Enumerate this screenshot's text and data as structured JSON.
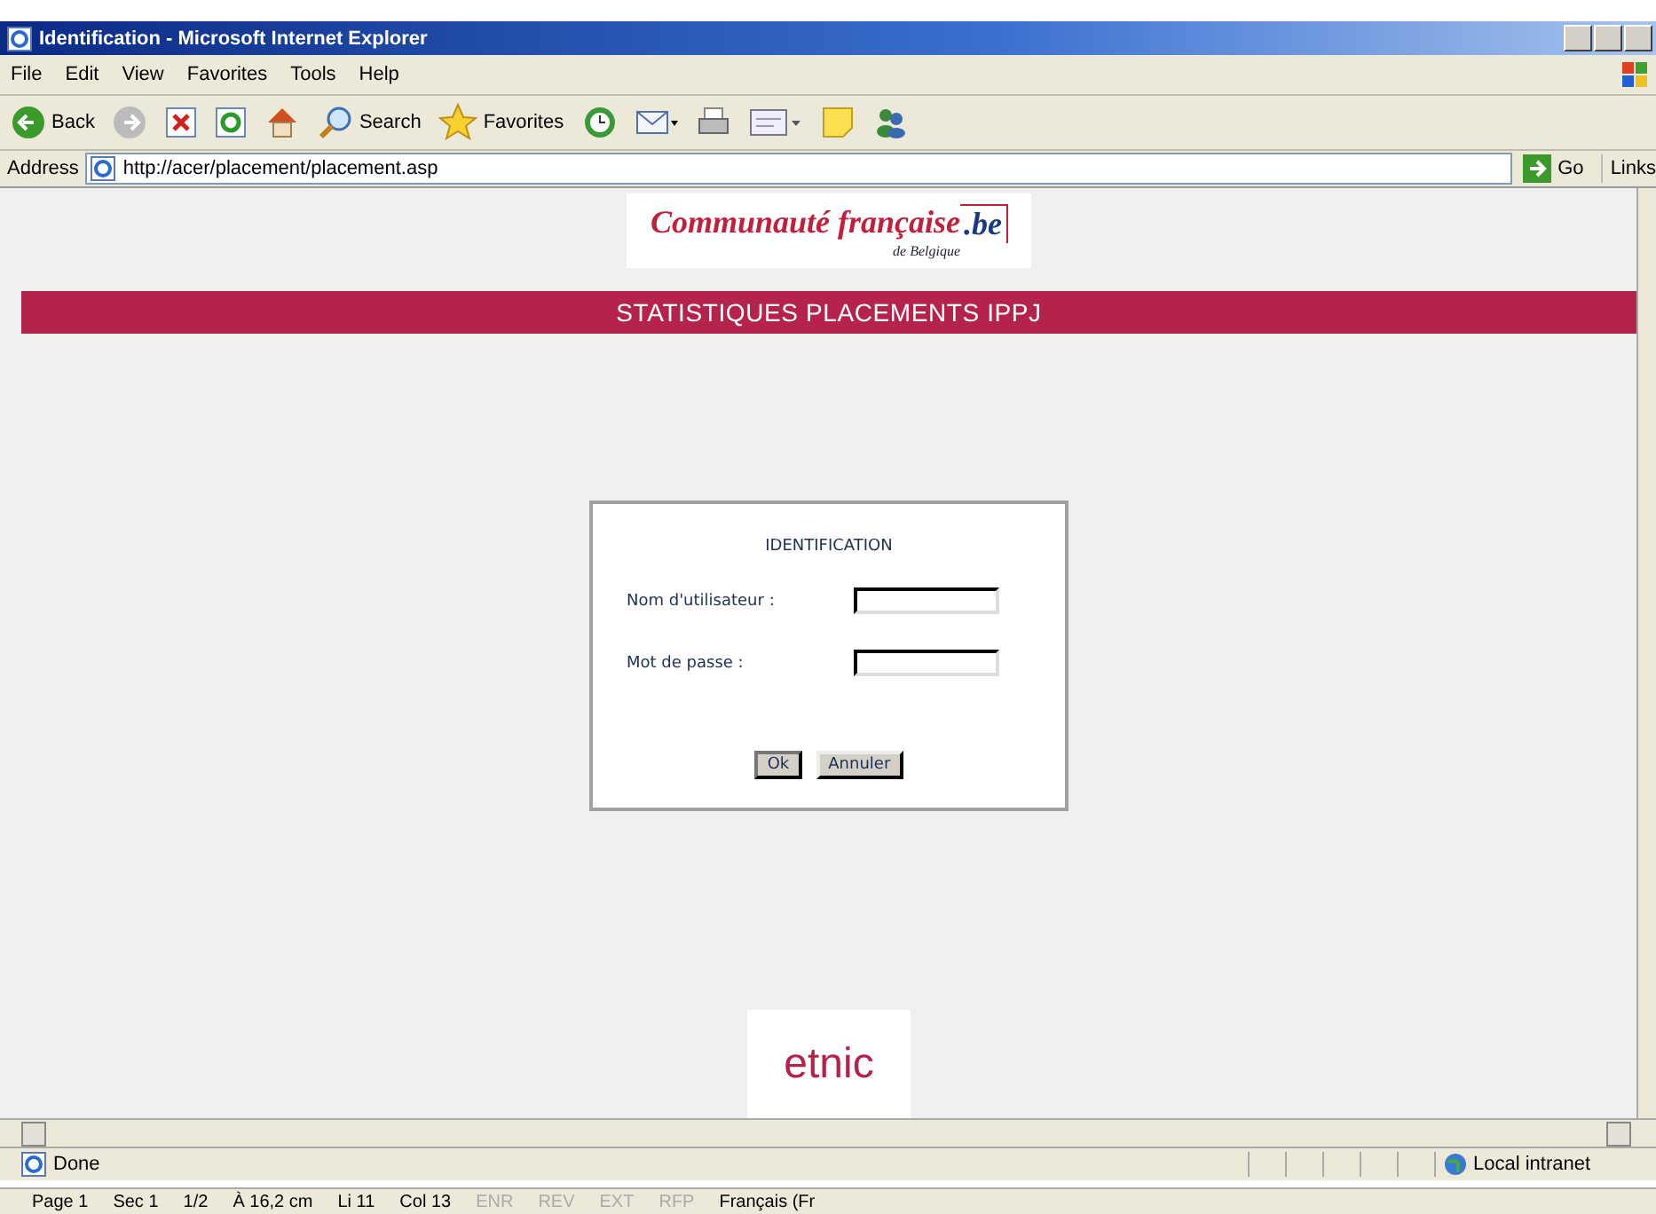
{
  "window": {
    "title": "Identification - Microsoft Internet Explorer"
  },
  "menu": [
    "File",
    "Edit",
    "View",
    "Favorites",
    "Tools",
    "Help"
  ],
  "toolbar": [
    {
      "kind": "back",
      "label": "Back"
    },
    {
      "kind": "forward"
    },
    {
      "kind": "stop"
    },
    {
      "kind": "refresh"
    },
    {
      "kind": "home"
    },
    {
      "kind": "search",
      "label": "Search"
    },
    {
      "kind": "favorites",
      "label": "Favorites"
    },
    {
      "kind": "history"
    },
    {
      "kind": "mail"
    },
    {
      "kind": "print"
    },
    {
      "kind": "edit"
    },
    {
      "kind": "note"
    },
    {
      "kind": "messenger"
    }
  ],
  "address": {
    "label": "Address",
    "url": "http://acer/placement/placement.asp",
    "go": "Go",
    "links": "Links"
  },
  "page": {
    "logo": {
      "main": "Communauté française",
      "suffix": ".be",
      "sub": "de Belgique"
    },
    "banner": "STATISTIQUES PLACEMENTS IPPJ",
    "form": {
      "title": "IDENTIFICATION",
      "fields": [
        {
          "label": "Nom d'utilisateur :"
        },
        {
          "label": "Mot de passe :"
        }
      ],
      "buttons": [
        "Ok",
        "Annuler"
      ]
    },
    "footer_logo": "etnic"
  },
  "status_bar": {
    "text": "Done",
    "zone": "Local intranet"
  },
  "word_status": [
    {
      "text": "Page 1",
      "disabled": false
    },
    {
      "text": "Sec 1",
      "disabled": false
    },
    {
      "text": "1/2",
      "disabled": false
    },
    {
      "text": "À 16,2 cm",
      "disabled": false
    },
    {
      "text": "Li 11",
      "disabled": false
    },
    {
      "text": "Col 13",
      "disabled": false
    },
    {
      "text": "ENR",
      "disabled": true
    },
    {
      "text": "REV",
      "disabled": true
    },
    {
      "text": "EXT",
      "disabled": true
    },
    {
      "text": "RFP",
      "disabled": true
    },
    {
      "text": "Français (Fr",
      "disabled": false
    }
  ]
}
